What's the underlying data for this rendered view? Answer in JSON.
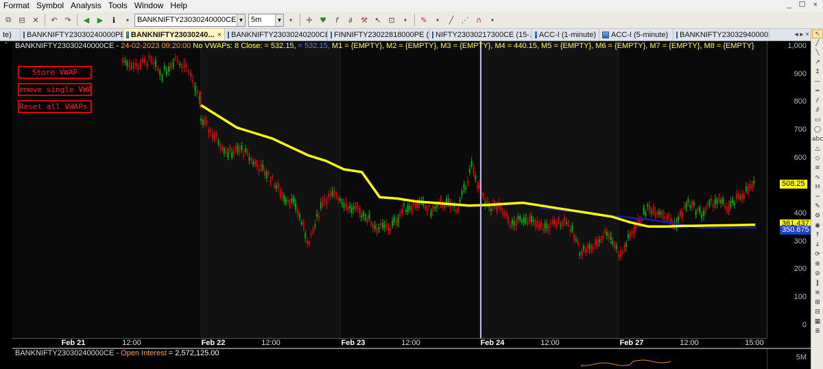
{
  "menu": {
    "items": [
      "Format",
      "Symbol",
      "Analysis",
      "Tools",
      "Window",
      "Help"
    ],
    "window_controls": "_ ☐ ×"
  },
  "toolbar": {
    "symbol_value": "BANKNIFTY23030240000CE",
    "interval_value": "5m"
  },
  "tabs": [
    {
      "label": "te)",
      "active": false,
      "icon": false
    },
    {
      "label": "BANKNIFTY23030240000PE...",
      "active": false,
      "icon": true
    },
    {
      "label": "BANKNIFTY23030240...",
      "active": true,
      "icon": true,
      "close": "×"
    },
    {
      "label": "BANKNIFTY23030240200CE...",
      "active": false,
      "icon": true
    },
    {
      "label": "FINNIFTY23022818000PE (1...",
      "active": false,
      "icon": true
    },
    {
      "label": "NIFTY23030217300CE (15-...",
      "active": false,
      "icon": true
    },
    {
      "label": "ACC-I (1-minute)",
      "active": false,
      "icon": true
    },
    {
      "label": "ACC-I (5-minute)",
      "active": false,
      "icon": true
    },
    {
      "label": "BANKNIFTY23032940000PE...",
      "active": false,
      "icon": true
    }
  ],
  "tab_nav": "◂ ▸ ×",
  "chart_header": {
    "symbol": "BANKNIFTY23030240000CE",
    "sep": " - ",
    "date": "24-02-2023 09:20:00",
    "vwaps": " No VWAPs: 8 Close: = 532.15,",
    "m0": " = 532.15,",
    "m1": " M1 = {EMPTY},",
    "m2": " M2 = {EMPTY},",
    "m3": " M3 = {EMPTY},",
    "m4": " M4 = 440.15,",
    "m5": " M5 = {EMPTY},",
    "m6": " M6 = {EMPTY},",
    "m7": " M7 = {EMPTY},",
    "m8": " M8 = {EMPTY}"
  },
  "vwap_buttons": {
    "store": "Store VWAP",
    "remove": "emove single VWA",
    "reset": "Reset all VWAPs"
  },
  "colors": {
    "bull": "#00b000",
    "bear": "#e00000",
    "vwap_main": "#ffff00",
    "vwap_second": "#1a1aa8",
    "cursor": "#b8b8ff",
    "button_border": "#e00000",
    "tag_yellow": "#ffff00",
    "tag_blue": "#1f3fd0"
  },
  "price_axis": {
    "ticks": [
      "1,000",
      "900",
      "800",
      "700",
      "600",
      "500",
      "400",
      "300",
      "200",
      "100",
      "0"
    ],
    "tags": [
      {
        "label": "508.25",
        "value": 508.25,
        "style": "yellow"
      },
      {
        "label": "361.437",
        "value": 361.437,
        "style": "yellow"
      },
      {
        "label": "350.675",
        "value": 350.675,
        "style": "blue"
      }
    ]
  },
  "time_axis": [
    {
      "label": "Feb 21",
      "day": true
    },
    {
      "label": "12:00",
      "day": false
    },
    {
      "label": "Feb 22",
      "day": true
    },
    {
      "label": "12:00",
      "day": false
    },
    {
      "label": "Feb 23",
      "day": true
    },
    {
      "label": "12:00",
      "day": false
    },
    {
      "label": "Feb 24",
      "day": true
    },
    {
      "label": "12:00",
      "day": false
    },
    {
      "label": "Feb 27",
      "day": true
    },
    {
      "label": "12:00",
      "day": false
    },
    {
      "label": "15:00",
      "day": false
    }
  ],
  "lower_pane": {
    "symbol": "BANKNIFTY23030240000CE",
    "sep": " - ",
    "label": "Open Interest",
    "value": " = 2,572,125.00",
    "axis_label": "5M"
  },
  "chart_data": {
    "type": "line",
    "ylim": [
      0,
      1000
    ],
    "x": [
      "Feb 21",
      "Feb 22",
      "Feb 23",
      "Feb 24",
      "Feb 27"
    ],
    "series": [
      {
        "values_price": [
          950,
          930,
          950,
          900,
          960,
          920,
          780,
          740,
          680,
          620,
          630,
          580,
          540,
          470,
          430,
          290,
          450,
          470,
          420,
          400,
          350,
          350,
          420,
          440,
          410,
          440,
          420,
          570,
          430,
          420,
          360,
          390,
          350,
          360,
          380,
          270,
          280,
          340,
          250,
          350,
          420,
          410,
          360,
          440,
          400,
          450,
          420,
          470,
          508
        ]
      },
      {
        "values_vwap_yellow": [
          790,
          750,
          710,
          690,
          670,
          640,
          610,
          590,
          560,
          550,
          460,
          455,
          445,
          440,
          435,
          430,
          432,
          436,
          440,
          430,
          420,
          410,
          400,
          390,
          370,
          355,
          355,
          357,
          358,
          359,
          360,
          361.4
        ]
      },
      {
        "values_vwap_blue": [
          420,
          410,
          400,
          390,
          380,
          365,
          350,
          350,
          351
        ]
      }
    ],
    "cursor_date": "Feb 24"
  },
  "right_tools": [
    "↖",
    "╱",
    "╲",
    "↗",
    "↕",
    "—",
    "═",
    "⫽",
    "⫻",
    "▭",
    "◯",
    "abc",
    "△",
    "◇",
    "≋",
    "∿",
    "H",
    "∼",
    "✎",
    "⚙",
    "◉",
    "↑",
    "↓",
    "⟳",
    "⊕",
    "⊘",
    "‖",
    "≡",
    "⊞",
    "⊟",
    "▦",
    "≣"
  ]
}
